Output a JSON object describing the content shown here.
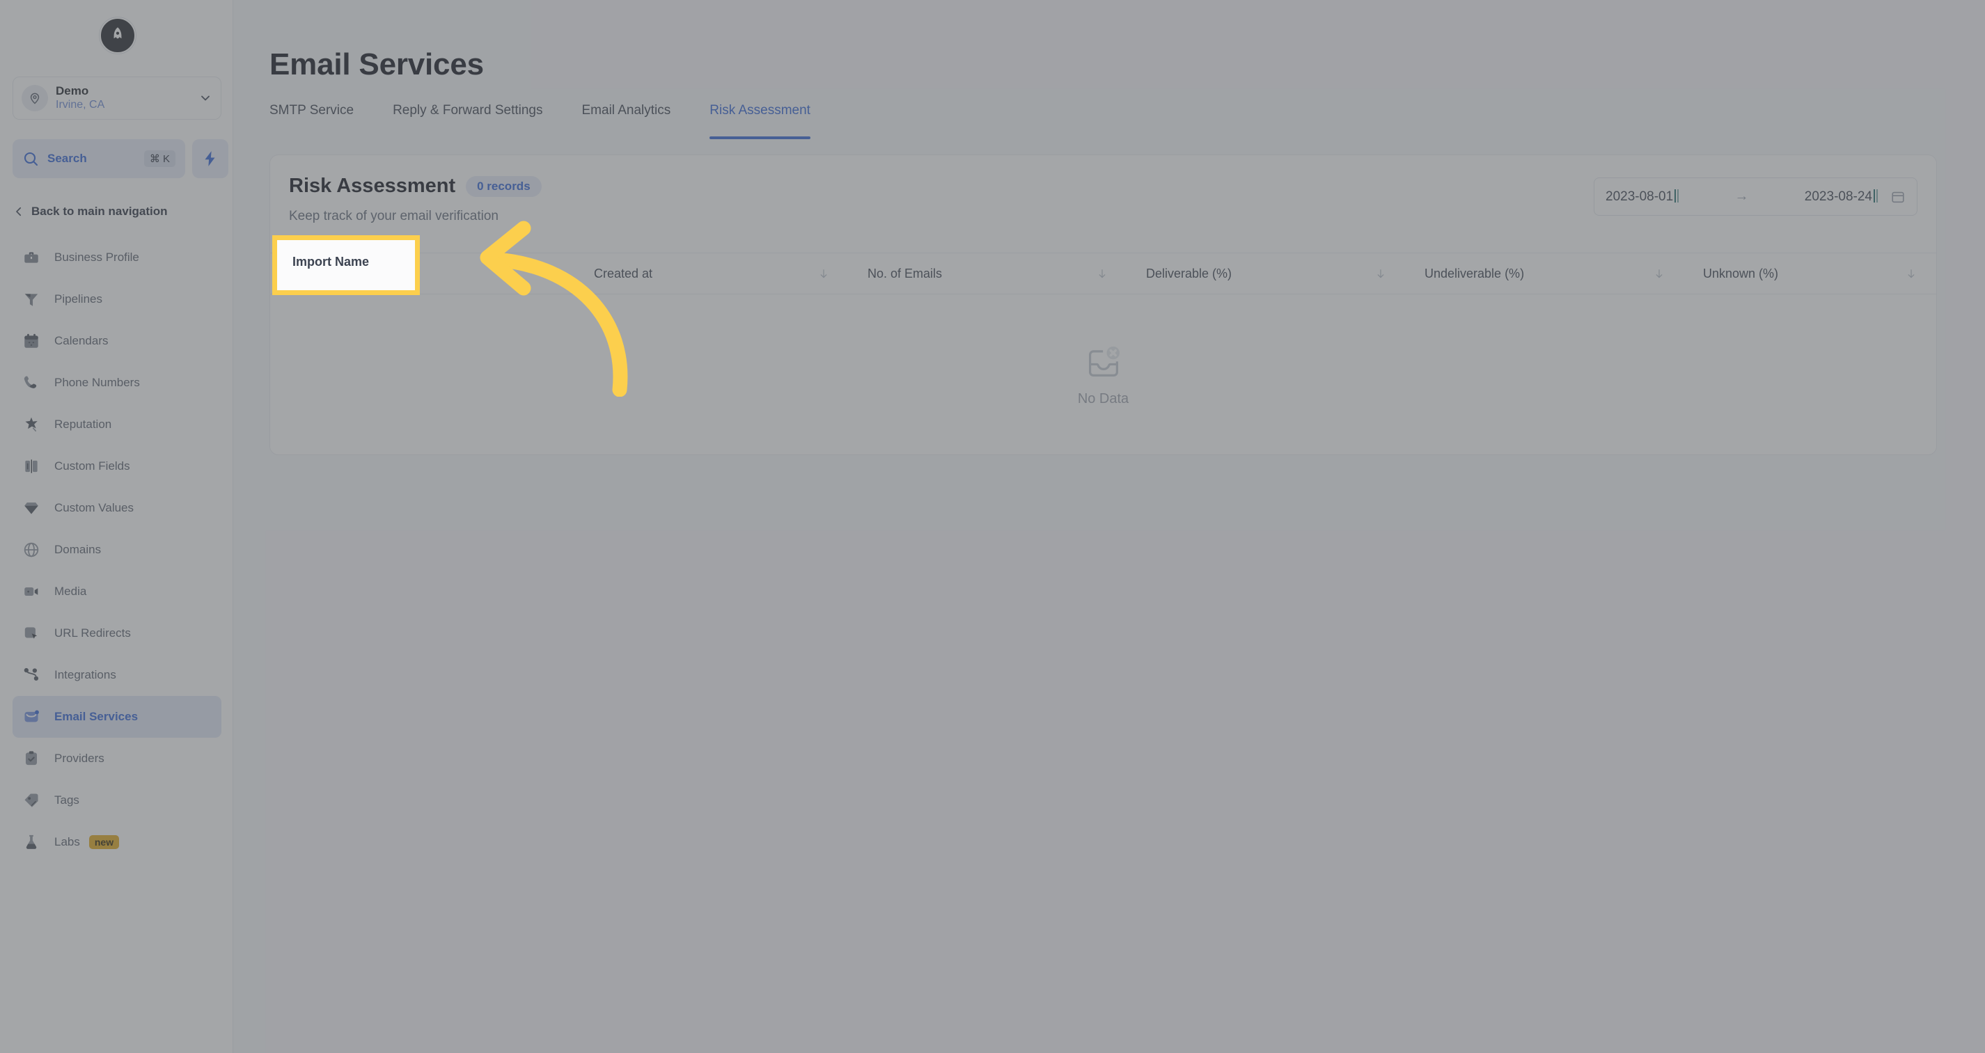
{
  "sidebar": {
    "logo_icon": "rocket-logo-icon",
    "location": {
      "avatar_icon": "location-pin-icon",
      "name": "Demo",
      "sublabel": "Irvine, CA",
      "chevron_icon": "chevron-down-icon"
    },
    "search": {
      "icon": "search-icon",
      "label": "Search",
      "shortcut": "⌘ K"
    },
    "quick_action_icon": "lightning-bolt-icon",
    "back_nav": {
      "icon": "chevron-left-icon",
      "label": "Back to main navigation"
    },
    "items": [
      {
        "label": "Business Profile",
        "icon": "briefcase-icon",
        "active": false
      },
      {
        "label": "Pipelines",
        "icon": "funnel-icon",
        "active": false
      },
      {
        "label": "Calendars",
        "icon": "calendar-icon",
        "active": false
      },
      {
        "label": "Phone Numbers",
        "icon": "phone-icon",
        "active": false
      },
      {
        "label": "Reputation",
        "icon": "star-icon",
        "active": false
      },
      {
        "label": "Custom Fields",
        "icon": "fields-icon",
        "active": false
      },
      {
        "label": "Custom Values",
        "icon": "gem-icon",
        "active": false
      },
      {
        "label": "Domains",
        "icon": "globe-icon",
        "active": false
      },
      {
        "label": "Media",
        "icon": "video-icon",
        "active": false
      },
      {
        "label": "URL Redirects",
        "icon": "cursor-box-icon",
        "active": false
      },
      {
        "label": "Integrations",
        "icon": "nodes-icon",
        "active": false
      },
      {
        "label": "Email Services",
        "icon": "envelope-icon",
        "active": true
      },
      {
        "label": "Providers",
        "icon": "clipboard-check-icon",
        "active": false
      },
      {
        "label": "Tags",
        "icon": "tag-icon",
        "active": false
      },
      {
        "label": "Labs",
        "icon": "flask-icon",
        "active": false,
        "badge": "new"
      }
    ]
  },
  "main": {
    "page_title": "Email Services",
    "tabs": [
      {
        "label": "SMTP Service",
        "active": false
      },
      {
        "label": "Reply & Forward Settings",
        "active": false
      },
      {
        "label": "Email Analytics",
        "active": false
      },
      {
        "label": "Risk Assessment",
        "active": true
      }
    ],
    "card": {
      "title": "Risk Assessment",
      "records_badge": "0 records",
      "subtitle": "Keep track of your email verification",
      "date_range": {
        "start": "2023-08-01",
        "end": "2023-08-24",
        "separator_icon": "arrow-right-icon",
        "calendar_icon": "calendar-icon"
      },
      "columns": [
        {
          "label": "Import Name",
          "sort_icon": "sort-down-icon"
        },
        {
          "label": "Created at",
          "sort_icon": "sort-down-icon"
        },
        {
          "label": "No. of Emails",
          "sort_icon": "sort-down-icon"
        },
        {
          "label": "Deliverable (%)",
          "sort_icon": "sort-down-icon"
        },
        {
          "label": "Undeliverable (%)",
          "sort_icon": "sort-down-icon"
        },
        {
          "label": "Unknown (%)",
          "sort_icon": "sort-down-icon"
        }
      ],
      "rows": [],
      "empty_state": {
        "icon": "inbox-x-icon",
        "text": "No Data"
      }
    }
  },
  "annotation": {
    "highlight_target": "Import Name",
    "arrow_icon": "curved-arrow-left-icon",
    "highlight_color": "#fccf4d"
  }
}
